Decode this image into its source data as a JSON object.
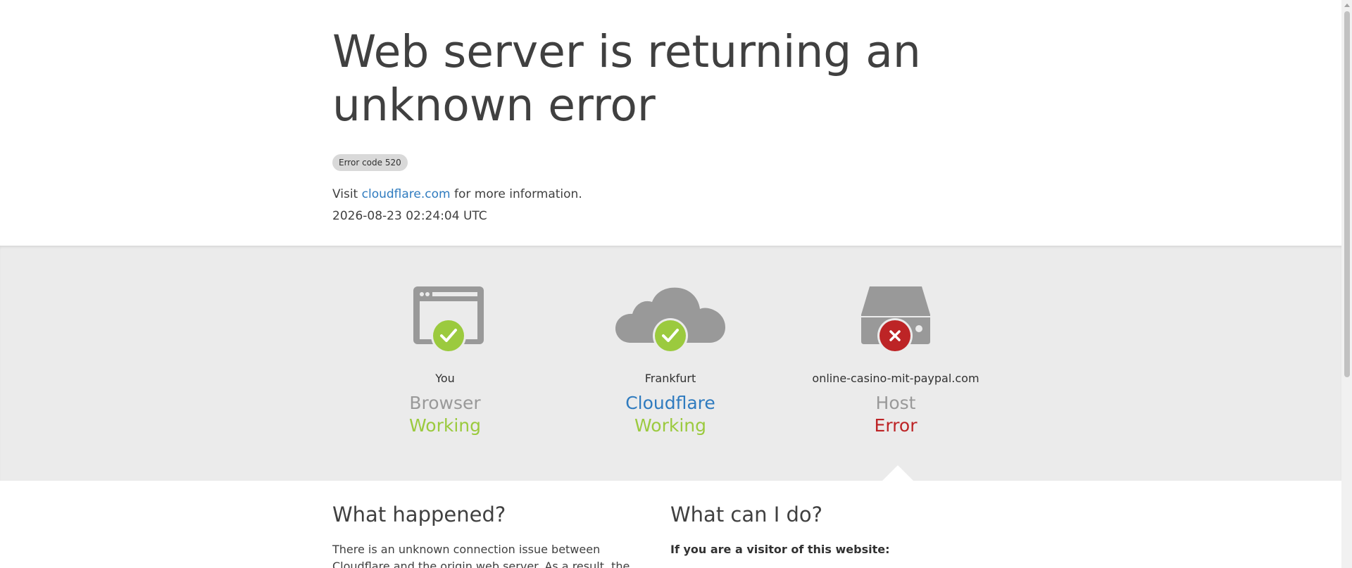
{
  "page": {
    "title": "Web server is returning an unknown error",
    "error_code": "Error code 520",
    "visit_prefix": "Visit",
    "visit_link": "cloudflare.com",
    "visit_suffix": "for more information.",
    "timestamp": "2026-08-23 02:24:04 UTC"
  },
  "status": [
    {
      "location": "You",
      "name": "Browser",
      "state": "Working",
      "state_kind": "ok",
      "icon": "browser-icon"
    },
    {
      "location": "Frankfurt",
      "name": "Cloudflare",
      "state": "Working",
      "state_kind": "ok",
      "icon": "cloud-icon"
    },
    {
      "location": "online-casino-mit-paypal.com",
      "name": "Host",
      "state": "Error",
      "state_kind": "error",
      "icon": "server-icon"
    }
  ],
  "details": {
    "what_happened_heading": "What happened?",
    "what_happened_text": "There is an unknown connection issue between Cloudflare and the origin web server. As a result, the",
    "what_can_i_do_heading": "What can I do?",
    "visitor_heading": "If you are a visitor of this website:"
  },
  "colors": {
    "working": "#9bca3e",
    "error": "#bd2426",
    "link": "#2f7bbf",
    "icon_gray": "#999999",
    "band_background": "#ebebeb"
  }
}
